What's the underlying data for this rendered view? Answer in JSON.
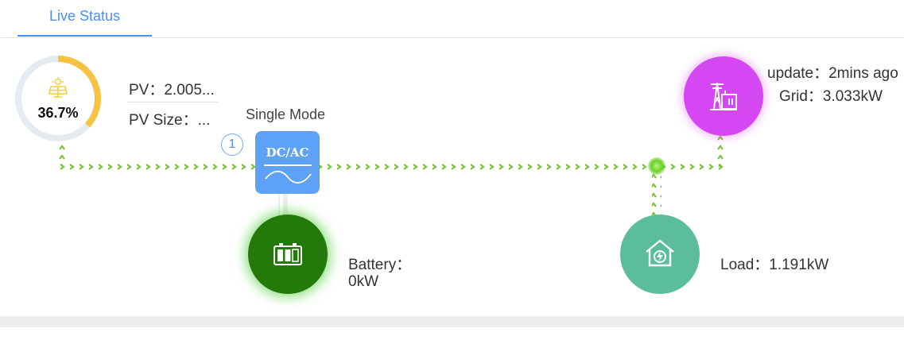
{
  "tabs": {
    "live_status": "Live Status"
  },
  "pv": {
    "percent_label": "36.7%",
    "percent_value": 36.7,
    "power_text": "PV：2.005...",
    "size_text": "PV Size：..."
  },
  "mode": {
    "text": "Single Mode",
    "badge": "1"
  },
  "inverter": {
    "label": "DC/AC"
  },
  "battery": {
    "line1": "Battery：",
    "line2": "0kW"
  },
  "grid": {
    "update_text": "update：2mins ago",
    "power_text": "Grid：3.033kW"
  },
  "load": {
    "power_text": "Load：1.191kW"
  },
  "colors": {
    "accent": "#4b8ef0",
    "gauge_fill": "#f5c242",
    "gauge_track": "#e6ebf2",
    "flow_green": "#7bc43f",
    "battery": "#237a0b",
    "load": "#5bbd9c",
    "grid": "#d447f2",
    "inverter": "#5ea2f8"
  },
  "icons": {
    "pv": "solar-panel-icon",
    "inverter": "inverter-wave-icon",
    "battery": "battery-icon",
    "load": "house-power-icon",
    "grid": "grid-tower-icon"
  }
}
